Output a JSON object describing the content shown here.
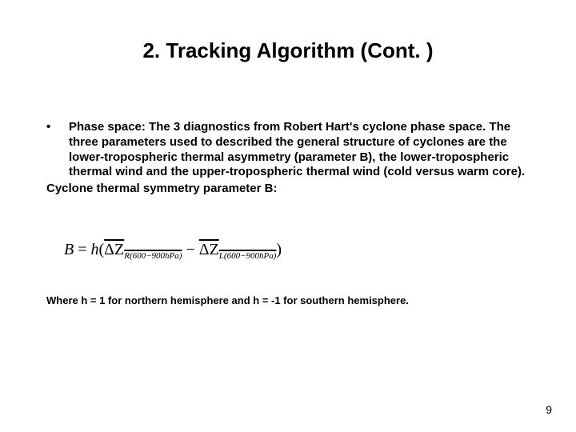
{
  "title": "2. Tracking Algorithm (Cont. )",
  "bullet": {
    "marker": "•",
    "text": "Phase space: The 3 diagnostics from Robert Hart's cyclone phase space. The three parameters used to described the general structure of cyclones are the lower-tropospheric thermal asymmetry (parameter B), the lower-tropospheric thermal wind and  the upper-tropospheric thermal wind (cold versus warm core)."
  },
  "post_bullet": "Cyclone thermal symmetry parameter B:",
  "equation": {
    "lhs": "B",
    "eq": " = ",
    "h": "h",
    "open": "(",
    "dz1_sym": "ΔZ",
    "dz1_sub": "R(600−900hPa)",
    "minus": " − ",
    "dz2_sym": "ΔZ",
    "dz2_sub": "L(600−900hPa)",
    "close": ")"
  },
  "footnote": "Where h = 1 for northern hemisphere and h = -1 for southern hemisphere.",
  "page_number": "9"
}
